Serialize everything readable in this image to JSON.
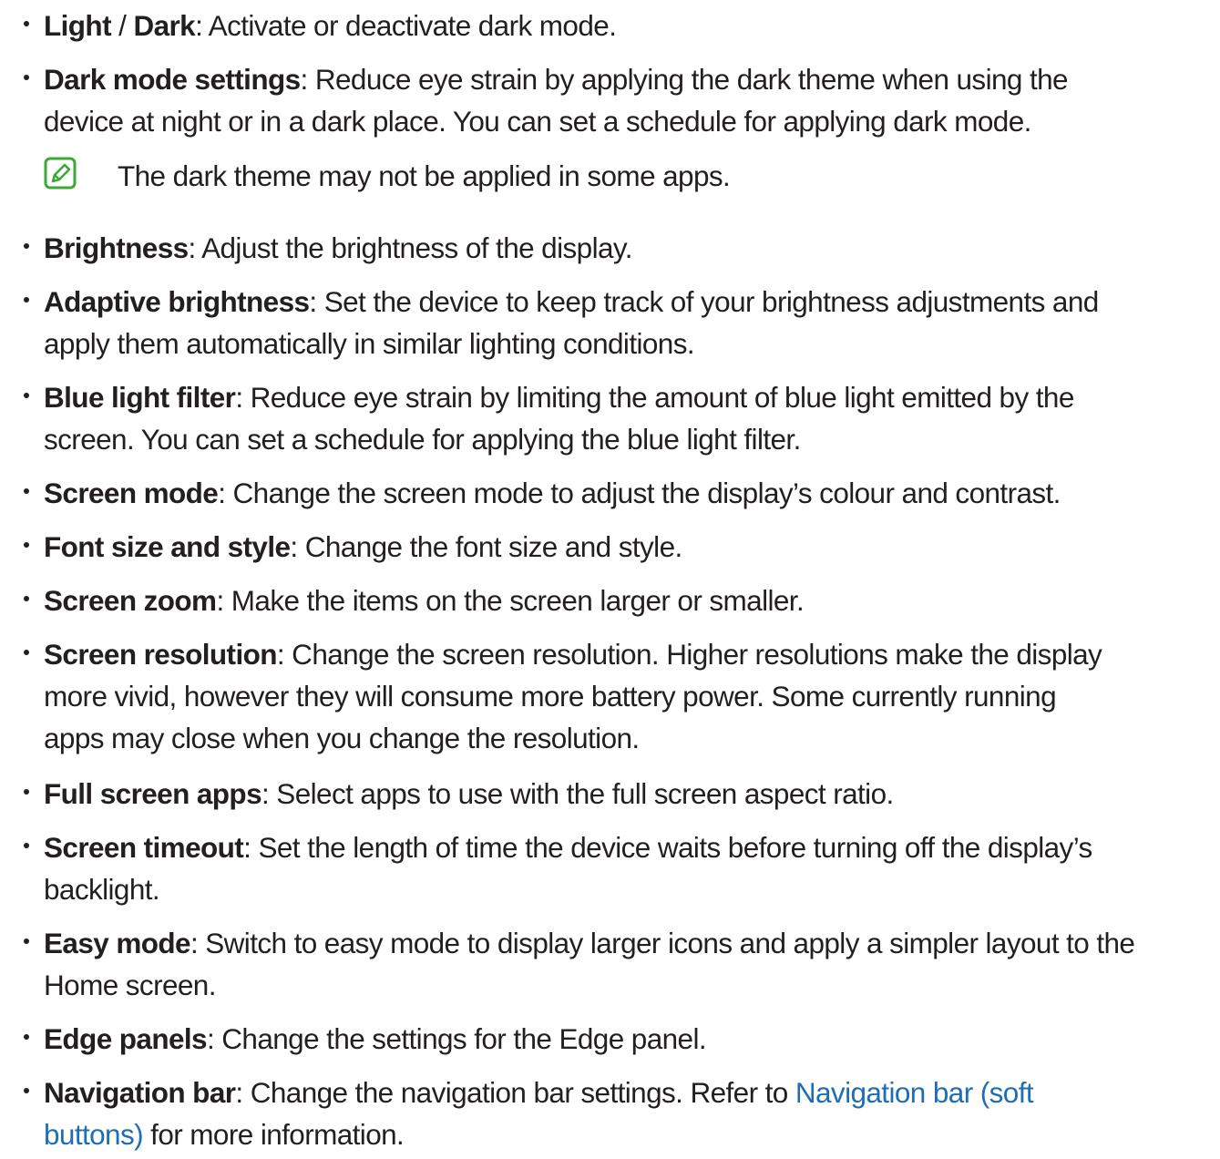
{
  "items": [
    {
      "term": "Light",
      "sep": " / ",
      "term2": "Dark",
      "desc": ": Activate or deactivate dark mode."
    },
    {
      "term": "Dark mode settings",
      "desc": ": Reduce eye strain by applying the dark theme when using the\ndevice at night or in a dark place. You can set a schedule for applying dark mode."
    },
    {
      "term": "Brightness",
      "desc": ": Adjust the brightness of the display."
    },
    {
      "term": "Adaptive brightness",
      "desc": ": Set the device to keep track of your brightness adjustments and\napply them automatically in similar lighting conditions."
    },
    {
      "term": "Blue light filter",
      "desc": ": Reduce eye strain by limiting the amount of blue light emitted by the\nscreen. You can set a schedule for applying the blue light filter."
    },
    {
      "term": "Screen mode",
      "desc": ": Change the screen mode to adjust the display’s colour and contrast."
    },
    {
      "term": "Font size and style",
      "desc": ": Change the font size and style."
    },
    {
      "term": "Screen zoom",
      "desc": ": Make the items on the screen larger or smaller."
    },
    {
      "term": "Screen resolution",
      "desc": ": Change the screen resolution. Higher resolutions make the display\nmore vivid, however they will consume more battery power. Some currently running\napps may close when you change the resolution."
    },
    {
      "term": "Full screen apps",
      "desc": ": Select apps to use with the full screen aspect ratio."
    },
    {
      "term": "Screen timeout",
      "desc": ": Set the length of time the device waits before turning off the display’s\nbacklight."
    },
    {
      "term": "Easy mode",
      "desc": ": Switch to easy mode to display larger icons and apply a simpler layout to the\nHome screen."
    },
    {
      "term": "Edge panels",
      "desc": ": Change the settings for the Edge panel."
    },
    {
      "term": "Navigation bar",
      "desc": ": Change the navigation bar settings. Refer to ",
      "link": "Navigation bar (soft\nbuttons)",
      "desc_after": " for more information."
    }
  ],
  "note": {
    "text": "The dark theme may not be applied in some apps.",
    "icon": "note-pencil-icon"
  },
  "colors": {
    "text": "#231f20",
    "link": "#1f6eb4",
    "note_icon": "#3aa935"
  }
}
